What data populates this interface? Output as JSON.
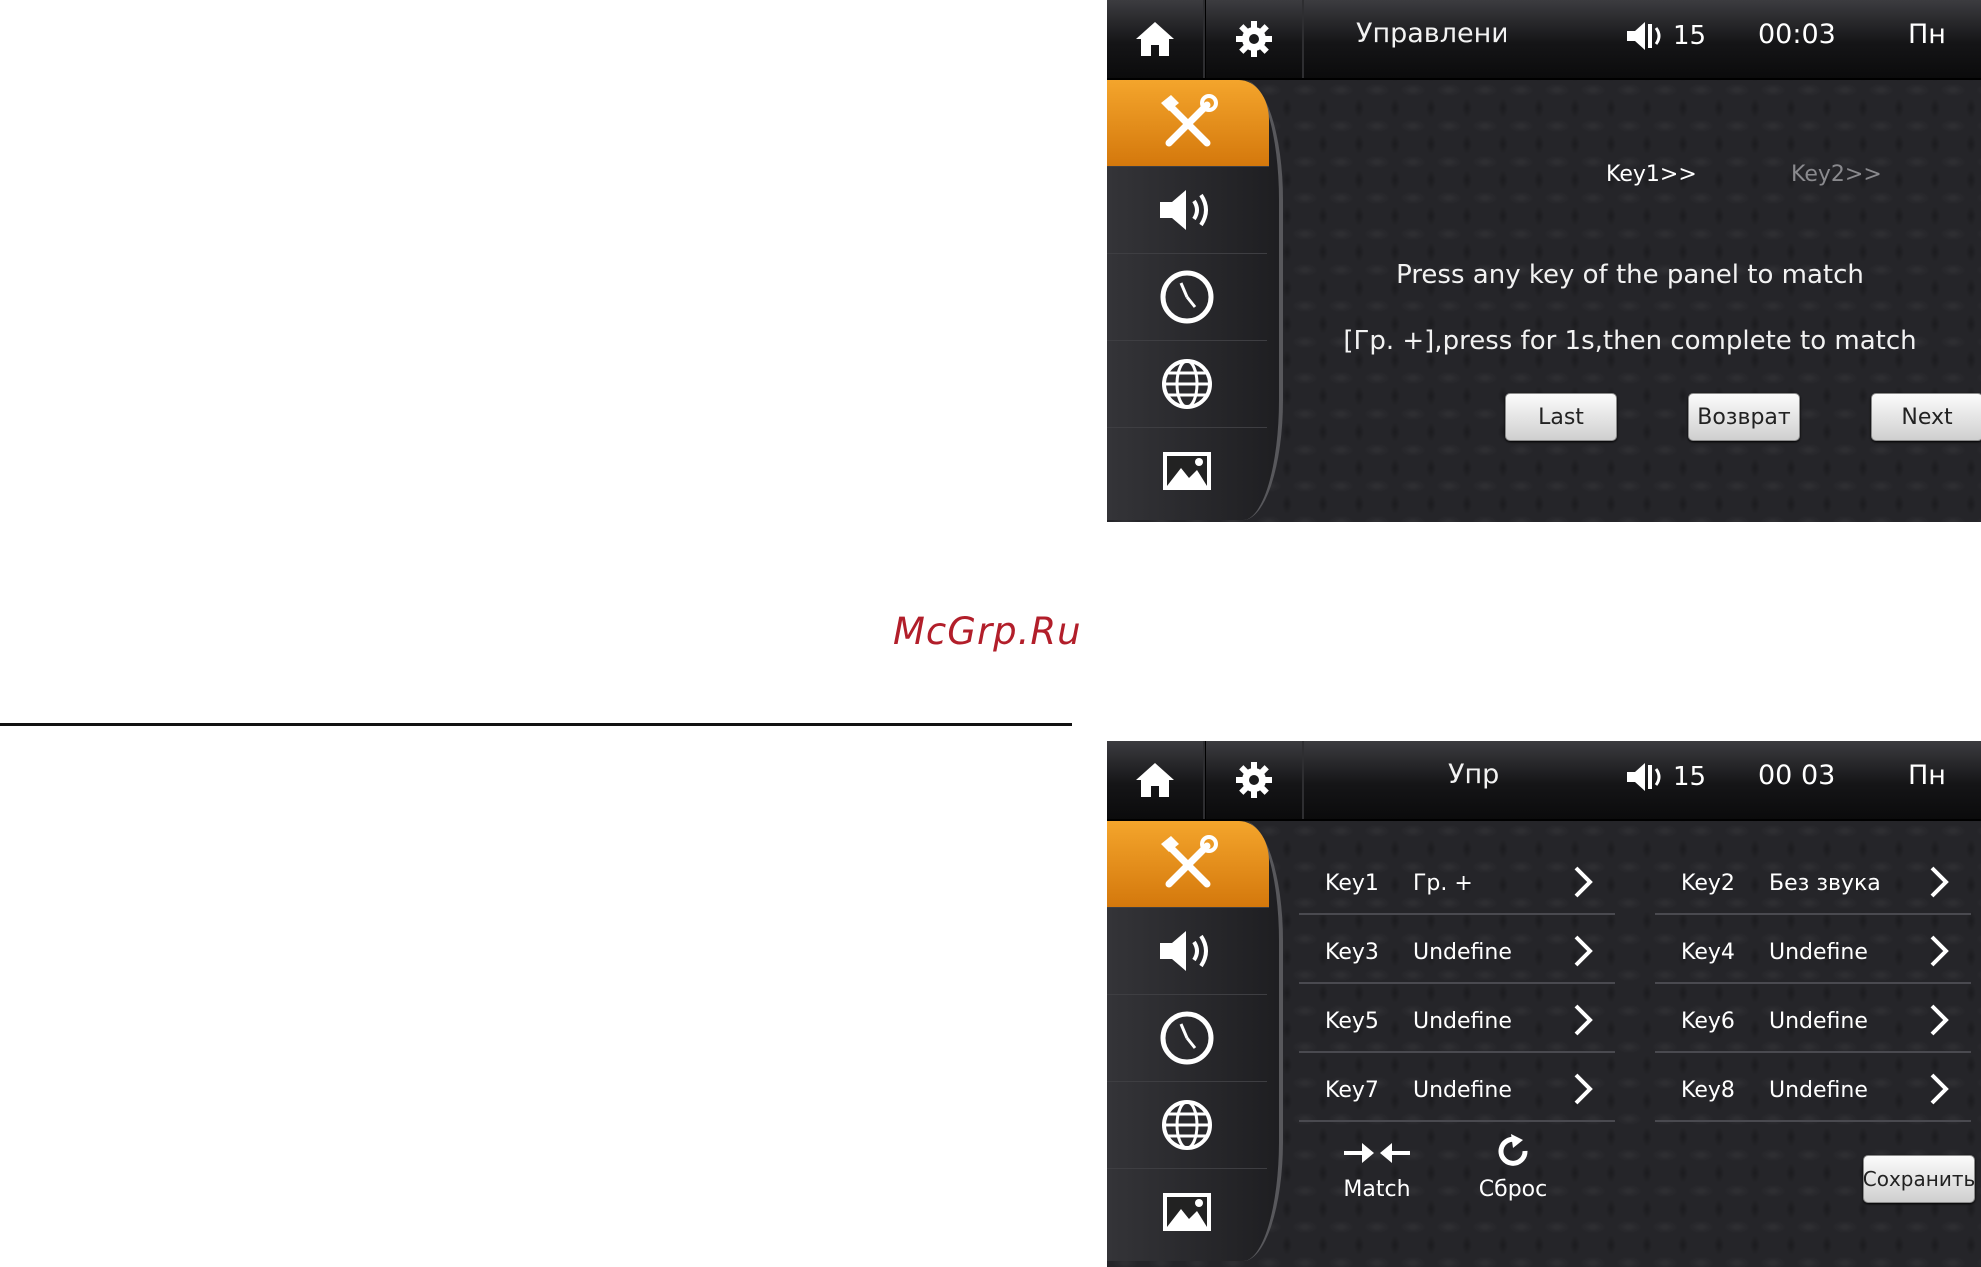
{
  "watermark": "McGrp.Ru",
  "screen1": {
    "topbar": {
      "title": "Управлени",
      "volume": "15",
      "time": "00:03",
      "day": "Пн"
    },
    "tabs": {
      "key1": "Key1>>",
      "key2": "Key2>>"
    },
    "message_line1": "Press any key of the panel to match",
    "message_line2": "[Гр. +],press for 1s,then complete to match",
    "buttons": {
      "last": "Last",
      "back": "Возврат",
      "next": "Next"
    }
  },
  "screen2": {
    "topbar": {
      "title": "Упр",
      "volume": "15",
      "time": "00 03",
      "day": "Пн"
    },
    "keys": [
      {
        "key": "Key1",
        "value": "Гр. +"
      },
      {
        "key": "Key2",
        "value": "Без звука"
      },
      {
        "key": "Key3",
        "value": "Undefine"
      },
      {
        "key": "Key4",
        "value": "Undefine"
      },
      {
        "key": "Key5",
        "value": "Undefine"
      },
      {
        "key": "Key6",
        "value": "Undefine"
      },
      {
        "key": "Key7",
        "value": "Undefine"
      },
      {
        "key": "Key8",
        "value": "Undefine"
      }
    ],
    "match_label": "Match",
    "reset_label": "Сброс",
    "save_label": "Сохранить"
  },
  "sidebar_icons": [
    "tools-icon",
    "speaker-icon",
    "clock-icon",
    "globe-icon",
    "picture-icon"
  ],
  "colors": {
    "accent": "#e88c14",
    "background": "#252529",
    "watermark": "#b21e2a"
  }
}
